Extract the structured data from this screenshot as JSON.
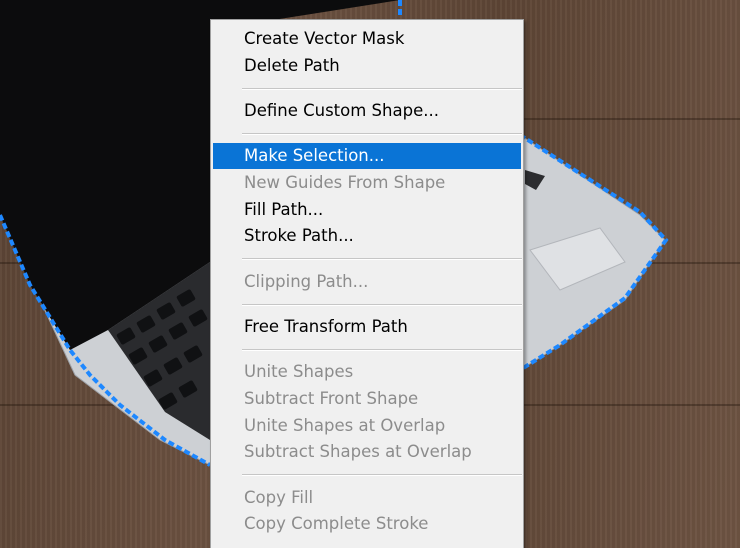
{
  "colors": {
    "menu_background": "#f0f0f0",
    "highlight": "#0a74d6",
    "disabled_text": "#8c8c8c",
    "path_outline": "#1e88ff",
    "laptop_body": "#cdd0d4",
    "laptop_screen": "#0c0c0d"
  },
  "context_menu": {
    "groups": [
      {
        "items": [
          {
            "label": "Create Vector Mask",
            "enabled": true,
            "highlighted": false
          },
          {
            "label": "Delete Path",
            "enabled": true,
            "highlighted": false
          }
        ]
      },
      {
        "items": [
          {
            "label": "Define Custom Shape...",
            "enabled": true,
            "highlighted": false
          }
        ]
      },
      {
        "items": [
          {
            "label": "Make Selection...",
            "enabled": true,
            "highlighted": true
          },
          {
            "label": "New Guides From Shape",
            "enabled": false,
            "highlighted": false
          },
          {
            "label": "Fill Path...",
            "enabled": true,
            "highlighted": false
          },
          {
            "label": "Stroke Path...",
            "enabled": true,
            "highlighted": false
          }
        ]
      },
      {
        "items": [
          {
            "label": "Clipping Path...",
            "enabled": false,
            "highlighted": false
          }
        ]
      },
      {
        "items": [
          {
            "label": "Free Transform Path",
            "enabled": true,
            "highlighted": false
          }
        ]
      },
      {
        "items": [
          {
            "label": "Unite Shapes",
            "enabled": false,
            "highlighted": false
          },
          {
            "label": "Subtract Front Shape",
            "enabled": false,
            "highlighted": false
          },
          {
            "label": "Unite Shapes at Overlap",
            "enabled": false,
            "highlighted": false
          },
          {
            "label": "Subtract Shapes at Overlap",
            "enabled": false,
            "highlighted": false
          }
        ]
      },
      {
        "items": [
          {
            "label": "Copy Fill",
            "enabled": false,
            "highlighted": false
          },
          {
            "label": "Copy Complete Stroke",
            "enabled": false,
            "highlighted": false
          }
        ]
      }
    ]
  }
}
